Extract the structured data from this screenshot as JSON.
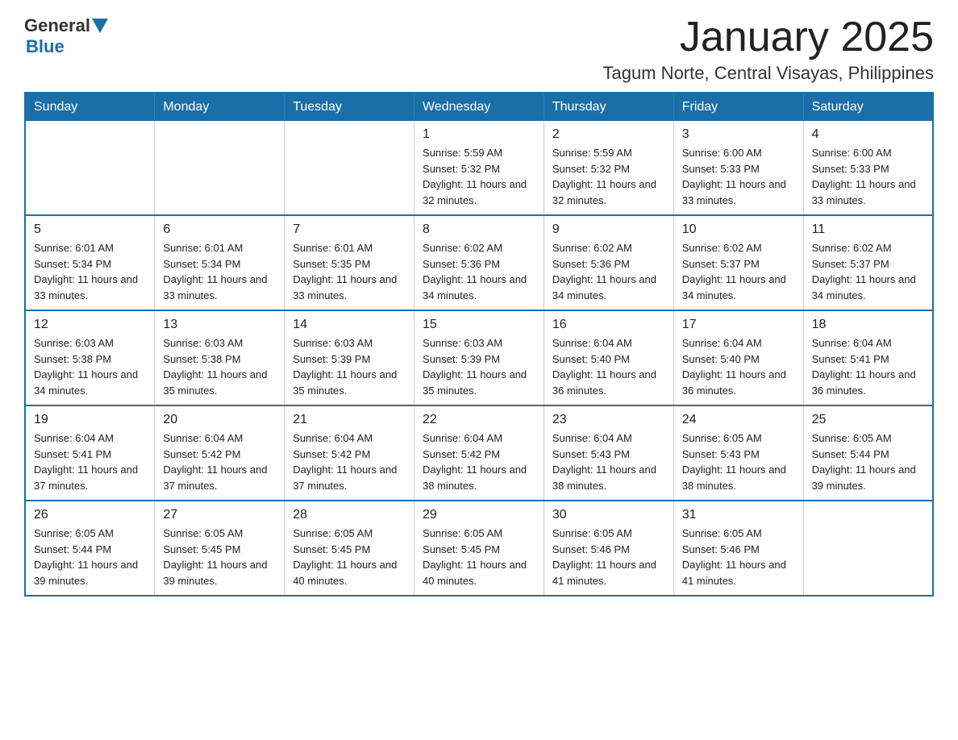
{
  "logo": {
    "text1": "General",
    "text2": "Blue"
  },
  "title": "January 2025",
  "subtitle": "Tagum Norte, Central Visayas, Philippines",
  "days_header": [
    "Sunday",
    "Monday",
    "Tuesday",
    "Wednesday",
    "Thursday",
    "Friday",
    "Saturday"
  ],
  "weeks": [
    [
      {
        "num": "",
        "info": ""
      },
      {
        "num": "",
        "info": ""
      },
      {
        "num": "",
        "info": ""
      },
      {
        "num": "1",
        "info": "Sunrise: 5:59 AM\nSunset: 5:32 PM\nDaylight: 11 hours and 32 minutes."
      },
      {
        "num": "2",
        "info": "Sunrise: 5:59 AM\nSunset: 5:32 PM\nDaylight: 11 hours and 32 minutes."
      },
      {
        "num": "3",
        "info": "Sunrise: 6:00 AM\nSunset: 5:33 PM\nDaylight: 11 hours and 33 minutes."
      },
      {
        "num": "4",
        "info": "Sunrise: 6:00 AM\nSunset: 5:33 PM\nDaylight: 11 hours and 33 minutes."
      }
    ],
    [
      {
        "num": "5",
        "info": "Sunrise: 6:01 AM\nSunset: 5:34 PM\nDaylight: 11 hours and 33 minutes."
      },
      {
        "num": "6",
        "info": "Sunrise: 6:01 AM\nSunset: 5:34 PM\nDaylight: 11 hours and 33 minutes."
      },
      {
        "num": "7",
        "info": "Sunrise: 6:01 AM\nSunset: 5:35 PM\nDaylight: 11 hours and 33 minutes."
      },
      {
        "num": "8",
        "info": "Sunrise: 6:02 AM\nSunset: 5:36 PM\nDaylight: 11 hours and 34 minutes."
      },
      {
        "num": "9",
        "info": "Sunrise: 6:02 AM\nSunset: 5:36 PM\nDaylight: 11 hours and 34 minutes."
      },
      {
        "num": "10",
        "info": "Sunrise: 6:02 AM\nSunset: 5:37 PM\nDaylight: 11 hours and 34 minutes."
      },
      {
        "num": "11",
        "info": "Sunrise: 6:02 AM\nSunset: 5:37 PM\nDaylight: 11 hours and 34 minutes."
      }
    ],
    [
      {
        "num": "12",
        "info": "Sunrise: 6:03 AM\nSunset: 5:38 PM\nDaylight: 11 hours and 34 minutes."
      },
      {
        "num": "13",
        "info": "Sunrise: 6:03 AM\nSunset: 5:38 PM\nDaylight: 11 hours and 35 minutes."
      },
      {
        "num": "14",
        "info": "Sunrise: 6:03 AM\nSunset: 5:39 PM\nDaylight: 11 hours and 35 minutes."
      },
      {
        "num": "15",
        "info": "Sunrise: 6:03 AM\nSunset: 5:39 PM\nDaylight: 11 hours and 35 minutes."
      },
      {
        "num": "16",
        "info": "Sunrise: 6:04 AM\nSunset: 5:40 PM\nDaylight: 11 hours and 36 minutes."
      },
      {
        "num": "17",
        "info": "Sunrise: 6:04 AM\nSunset: 5:40 PM\nDaylight: 11 hours and 36 minutes."
      },
      {
        "num": "18",
        "info": "Sunrise: 6:04 AM\nSunset: 5:41 PM\nDaylight: 11 hours and 36 minutes."
      }
    ],
    [
      {
        "num": "19",
        "info": "Sunrise: 6:04 AM\nSunset: 5:41 PM\nDaylight: 11 hours and 37 minutes."
      },
      {
        "num": "20",
        "info": "Sunrise: 6:04 AM\nSunset: 5:42 PM\nDaylight: 11 hours and 37 minutes."
      },
      {
        "num": "21",
        "info": "Sunrise: 6:04 AM\nSunset: 5:42 PM\nDaylight: 11 hours and 37 minutes."
      },
      {
        "num": "22",
        "info": "Sunrise: 6:04 AM\nSunset: 5:42 PM\nDaylight: 11 hours and 38 minutes."
      },
      {
        "num": "23",
        "info": "Sunrise: 6:04 AM\nSunset: 5:43 PM\nDaylight: 11 hours and 38 minutes."
      },
      {
        "num": "24",
        "info": "Sunrise: 6:05 AM\nSunset: 5:43 PM\nDaylight: 11 hours and 38 minutes."
      },
      {
        "num": "25",
        "info": "Sunrise: 6:05 AM\nSunset: 5:44 PM\nDaylight: 11 hours and 39 minutes."
      }
    ],
    [
      {
        "num": "26",
        "info": "Sunrise: 6:05 AM\nSunset: 5:44 PM\nDaylight: 11 hours and 39 minutes."
      },
      {
        "num": "27",
        "info": "Sunrise: 6:05 AM\nSunset: 5:45 PM\nDaylight: 11 hours and 39 minutes."
      },
      {
        "num": "28",
        "info": "Sunrise: 6:05 AM\nSunset: 5:45 PM\nDaylight: 11 hours and 40 minutes."
      },
      {
        "num": "29",
        "info": "Sunrise: 6:05 AM\nSunset: 5:45 PM\nDaylight: 11 hours and 40 minutes."
      },
      {
        "num": "30",
        "info": "Sunrise: 6:05 AM\nSunset: 5:46 PM\nDaylight: 11 hours and 41 minutes."
      },
      {
        "num": "31",
        "info": "Sunrise: 6:05 AM\nSunset: 5:46 PM\nDaylight: 11 hours and 41 minutes."
      },
      {
        "num": "",
        "info": ""
      }
    ]
  ]
}
